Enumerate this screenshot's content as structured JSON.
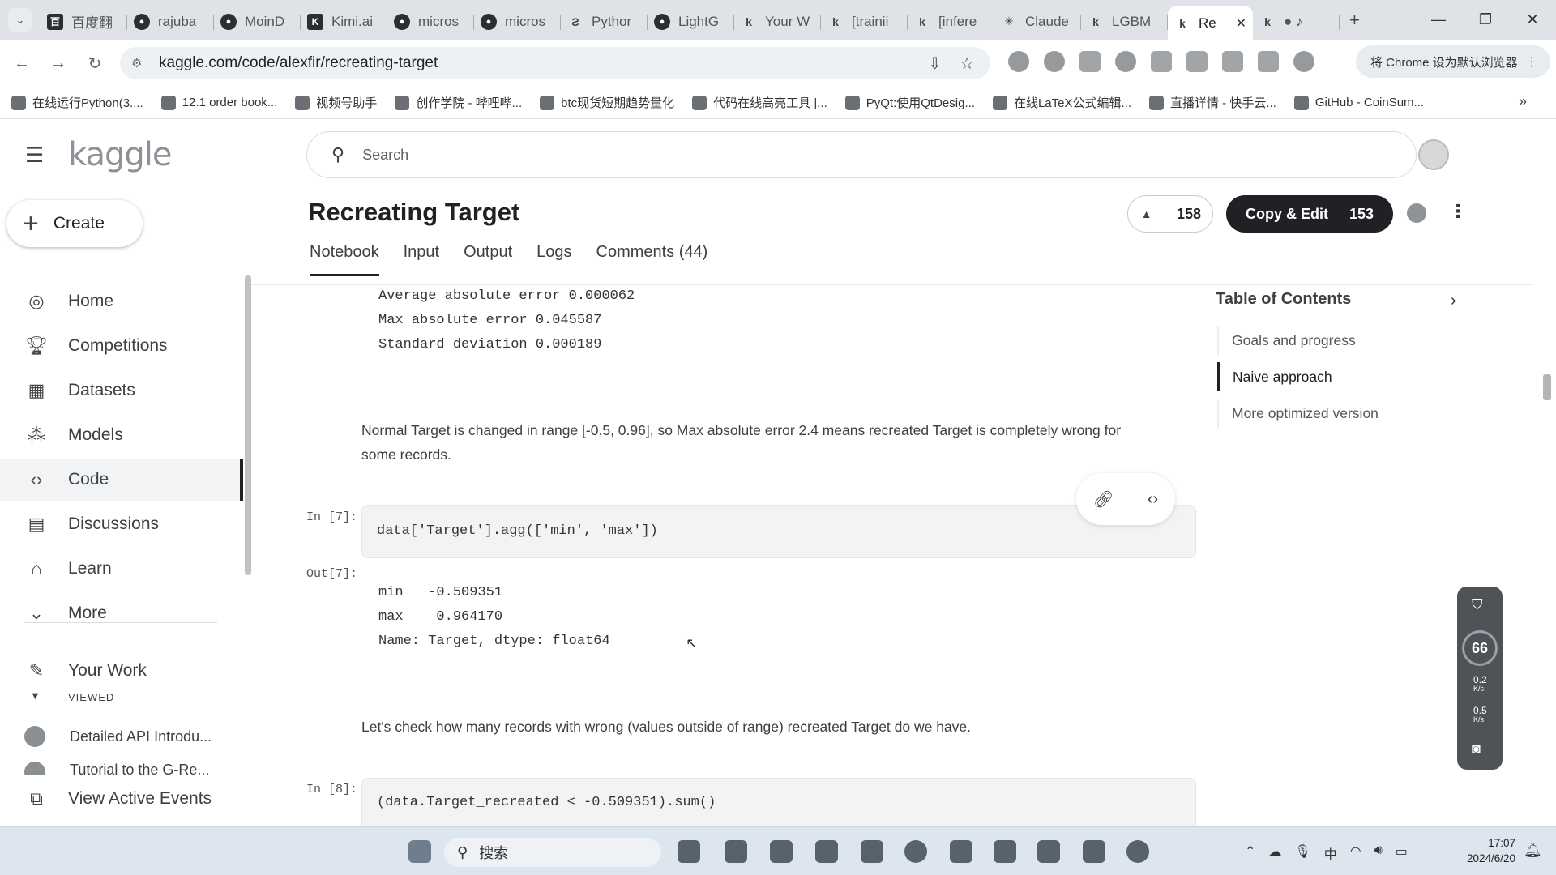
{
  "browser": {
    "tabs": [
      {
        "label": "百度翻",
        "icon": "baidu-icon"
      },
      {
        "label": "rajuba",
        "icon": "github-icon"
      },
      {
        "label": "MoinD",
        "icon": "github-icon"
      },
      {
        "label": "Kimi.ai",
        "icon": "kimi-icon"
      },
      {
        "label": "micros",
        "icon": "github-icon"
      },
      {
        "label": "micros",
        "icon": "github-icon"
      },
      {
        "label": "Pythor",
        "icon": "python-icon"
      },
      {
        "label": "LightG",
        "icon": "github-icon"
      },
      {
        "label": "Your W",
        "icon": "kaggle-icon"
      },
      {
        "label": "[trainii",
        "icon": "kaggle-icon"
      },
      {
        "label": "[infere",
        "icon": "kaggle-icon"
      },
      {
        "label": "Claude",
        "icon": "claude-icon"
      },
      {
        "label": "LGBM",
        "icon": "kaggle-icon"
      },
      {
        "label": "Re",
        "icon": "kaggle-icon",
        "active": true
      },
      {
        "label": "",
        "icon": "kaggle-icon"
      }
    ],
    "url": "kaggle.com/code/alexfir/recreating-target",
    "default_browser_label": "将 Chrome 设为默认浏览器",
    "bookmarks": [
      "在线运行Python(3....",
      "12.1 order book...",
      "视频号助手",
      "创作学院 - 哔哩哔...",
      "btc现货短期趋势量化",
      "代码在线高亮工具 |...",
      "PyQt:使用QtDesig...",
      "在线LaTeX公式编辑...",
      "直播详情 - 快手云...",
      "GitHub - CoinSum..."
    ]
  },
  "kaggle": {
    "logo": "kaggle",
    "create_label": "Create",
    "nav": [
      {
        "label": "Home",
        "icon": "compass-icon"
      },
      {
        "label": "Competitions",
        "icon": "trophy-icon"
      },
      {
        "label": "Datasets",
        "icon": "table-icon"
      },
      {
        "label": "Models",
        "icon": "models-icon"
      },
      {
        "label": "Code",
        "icon": "code-icon",
        "active": true
      },
      {
        "label": "Discussions",
        "icon": "discussion-icon"
      },
      {
        "label": "Learn",
        "icon": "learn-icon"
      },
      {
        "label": "More",
        "icon": "chevron-down-icon"
      }
    ],
    "your_work": "Your Work",
    "viewed_label": "VIEWED",
    "viewed_items": [
      "Detailed API Introdu...",
      "Tutorial to the G-Re..."
    ],
    "view_active_events": "View Active Events",
    "search_placeholder": "Search",
    "title": "Recreating Target",
    "votes": "158",
    "copy_edit_label": "Copy & Edit",
    "copy_edit_count": "153",
    "tabs": [
      "Notebook",
      "Input",
      "Output",
      "Logs",
      "Comments (44)"
    ]
  },
  "notebook": {
    "output_top": [
      "Average absolute error 0.000062",
      "Max absolute error 0.045587",
      "Standard deviation 0.000189"
    ],
    "md1_line1": "Normal Target is changed in range [-0.5, 0.96], so Max absolute error 2.4 means recreated Target is completely wrong for",
    "md1_line2": "some records.",
    "cell7_prompt": "In [7]:",
    "cell7_code": "data['Target'].agg(['min', 'max'])",
    "out7_prompt": "Out[7]:",
    "out7_lines": [
      "min   -0.509351",
      "max    0.964170",
      "Name: Target, dtype: float64"
    ],
    "md2": "Let's check how many records with wrong (values outside of range) recreated Target do we have.",
    "cell8_prompt": "In [8]:",
    "cell8_code": "(data.Target_recreated < -0.509351).sum()"
  },
  "toc": {
    "title": "Table of Contents",
    "items": [
      "Goals and progress",
      "Naive approach",
      "More optimized version"
    ],
    "active_index": 1
  },
  "net_widget": {
    "percent": "66",
    "up": "0.2",
    "down": "0.5",
    "unit": "K/s"
  },
  "taskbar": {
    "search_label": "搜索",
    "ime": "中",
    "time": "17:07",
    "date": "2024/6/20"
  }
}
